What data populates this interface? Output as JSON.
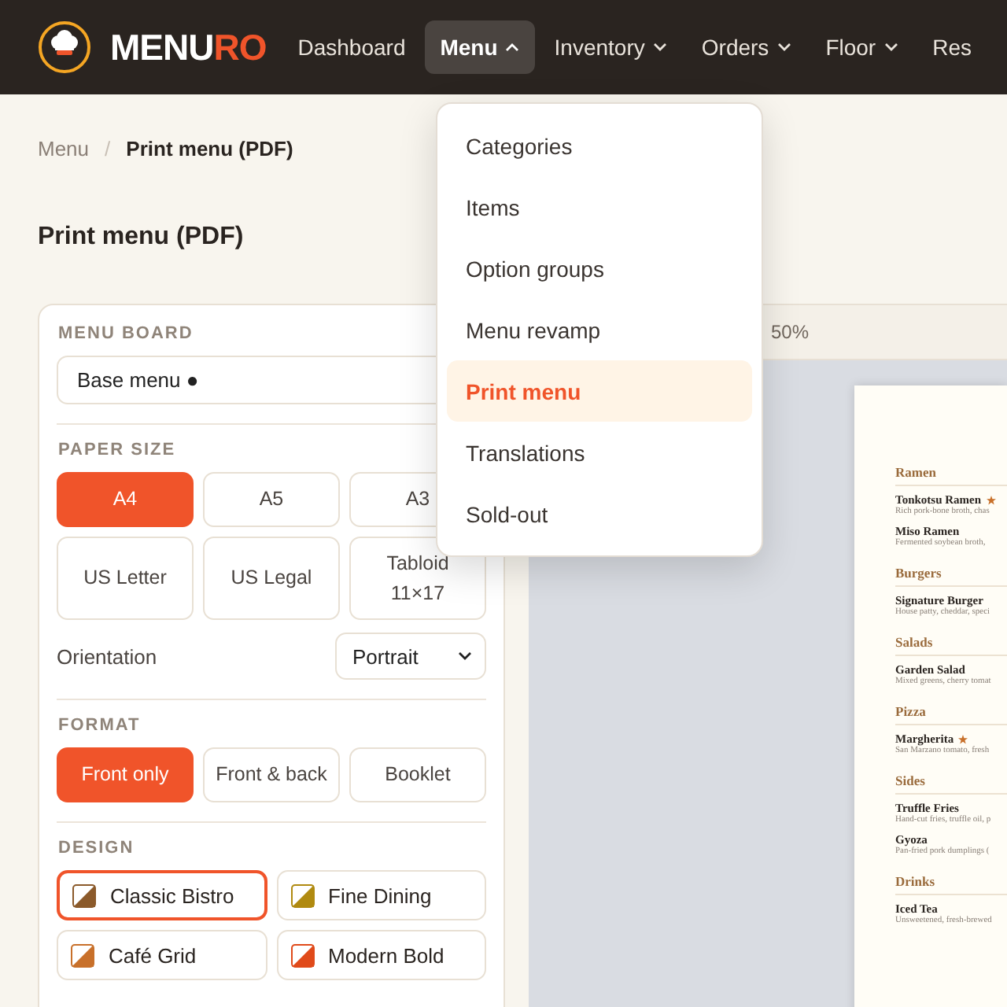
{
  "brand": {
    "name_main": "MENU",
    "name_accent": "RO"
  },
  "nav": [
    {
      "label": "Dashboard",
      "selected": false,
      "dropdown": false
    },
    {
      "label": "Menu",
      "selected": true,
      "dropdown": true
    },
    {
      "label": "Inventory",
      "selected": false,
      "dropdown": true
    },
    {
      "label": "Orders",
      "selected": false,
      "dropdown": true
    },
    {
      "label": "Floor",
      "selected": false,
      "dropdown": true
    },
    {
      "label": "Res",
      "selected": false,
      "dropdown": false
    }
  ],
  "breadcrumb": [
    "Menu",
    "Print menu (PDF)"
  ],
  "breadcrumb_separator": "/",
  "page_title": "Print menu (PDF)",
  "menu_dropdown": [
    {
      "label": "Categories",
      "selected": false
    },
    {
      "label": "Items",
      "selected": false
    },
    {
      "label": "Option groups",
      "selected": false
    },
    {
      "label": "Menu revamp",
      "selected": false
    },
    {
      "label": "Print menu",
      "selected": true
    },
    {
      "label": "Translations",
      "selected": false
    },
    {
      "label": "Sold-out",
      "selected": false
    }
  ],
  "settings": {
    "menu_board": {
      "label": "MENU BOARD",
      "value": "Base menu ●"
    },
    "paper_size": {
      "label": "PAPER SIZE",
      "options": [
        {
          "label": "A4",
          "selected": true
        },
        {
          "label": "A5",
          "selected": false
        },
        {
          "label": "A3",
          "selected": false
        },
        {
          "label": "US Letter",
          "selected": false
        },
        {
          "label": "US Legal",
          "selected": false
        },
        {
          "label": "Tabloid\n11×17",
          "selected": false
        }
      ]
    },
    "orientation": {
      "label": "Orientation",
      "value": "Portrait"
    },
    "format": {
      "label": "FORMAT",
      "options": [
        {
          "label": "Front only",
          "selected": true
        },
        {
          "label": "Front & back",
          "selected": false
        },
        {
          "label": "Booklet",
          "selected": false
        }
      ]
    },
    "design": {
      "label": "DESIGN",
      "options": [
        {
          "label": "Classic Bistro",
          "selected": true,
          "color": "#8b5a2b"
        },
        {
          "label": "Fine Dining",
          "selected": false,
          "color": "#b08a10"
        },
        {
          "label": "Café Grid",
          "selected": false,
          "color": "#c8702a"
        },
        {
          "label": "Modern Bold",
          "selected": false,
          "color": "#e04a1a"
        }
      ]
    }
  },
  "preview": {
    "zoom": "50%",
    "sections": [
      {
        "name": "Ramen",
        "items": [
          {
            "name": "Tonkotsu Ramen",
            "star": true,
            "desc": "Rich pork-bone broth, chas"
          },
          {
            "name": "Miso Ramen",
            "star": false,
            "desc": "Fermented soybean broth,"
          }
        ]
      },
      {
        "name": "Burgers",
        "items": [
          {
            "name": "Signature Burger",
            "star": false,
            "desc": "House patty, cheddar, speci"
          }
        ]
      },
      {
        "name": "Salads",
        "items": [
          {
            "name": "Garden Salad",
            "star": false,
            "desc": "Mixed greens, cherry tomat"
          }
        ]
      },
      {
        "name": "Pizza",
        "items": [
          {
            "name": "Margherita",
            "star": true,
            "desc": "San Marzano tomato, fresh"
          }
        ]
      },
      {
        "name": "Sides",
        "items": [
          {
            "name": "Truffle Fries",
            "star": false,
            "desc": "Hand-cut fries, truffle oil, p"
          },
          {
            "name": "Gyoza",
            "star": false,
            "desc": "Pan-fried pork dumplings ("
          }
        ]
      },
      {
        "name": "Drinks",
        "items": [
          {
            "name": "Iced Tea",
            "star": false,
            "desc": "Unsweetened, fresh-brewed"
          }
        ]
      }
    ]
  }
}
